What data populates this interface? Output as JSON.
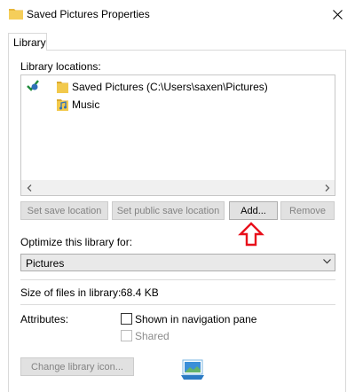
{
  "window": {
    "title": "Saved Pictures Properties"
  },
  "tabs": [
    {
      "label": "Library"
    }
  ],
  "library_locations": {
    "label": "Library locations:",
    "items": [
      {
        "name": "Saved Pictures (C:\\Users\\saxen\\Pictures)",
        "icon": "folder-icon",
        "is_default_save": true
      },
      {
        "name": "Music",
        "icon": "music-folder-icon",
        "is_default_save": false
      }
    ]
  },
  "buttons": {
    "set_save_location": "Set save location",
    "set_public_save_location": "Set public save location",
    "add": "Add...",
    "remove": "Remove",
    "change_icon": "Change library icon..."
  },
  "optimize": {
    "label": "Optimize this library for:",
    "selected": "Pictures"
  },
  "size": {
    "label": "Size of files in library:",
    "value": "68.4 KB"
  },
  "attributes": {
    "label": "Attributes:",
    "shown_in_nav": {
      "label": "Shown in navigation pane",
      "checked": false
    },
    "shared": {
      "label": "Shared",
      "checked": false
    }
  },
  "colors": {
    "annotation_arrow": "#e8101b",
    "folder": "#e8b73a",
    "panel_border": "#d9d9d9"
  }
}
